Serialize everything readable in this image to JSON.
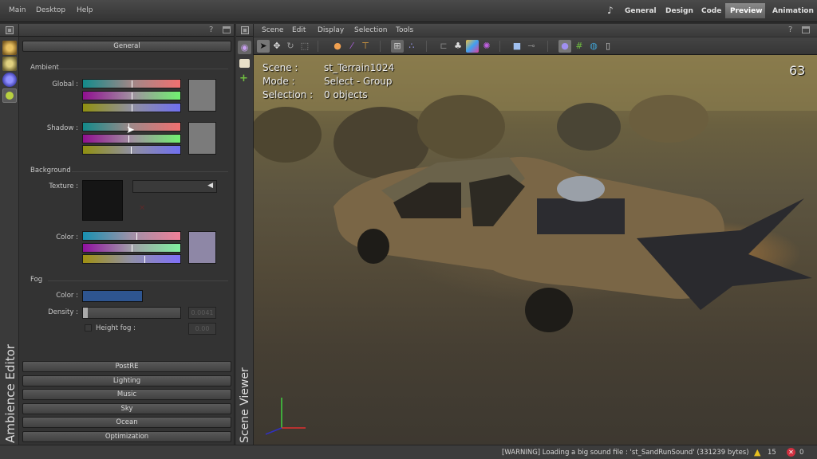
{
  "menubar": {
    "items": [
      "Main",
      "Desktop",
      "Help"
    ],
    "workspace_tabs": [
      "General",
      "Design",
      "Code",
      "Preview",
      "Animation"
    ],
    "active_workspace": "Preview",
    "music_icon": "music-note-icon"
  },
  "left_panel": {
    "title_vertical": "Ambience Editor",
    "help": "?",
    "general_button": "General",
    "ambient": {
      "label": "Ambient",
      "global_label": "Global :",
      "shadow_label": "Shadow :",
      "global_ticks": [
        0.5,
        0.5,
        0.5
      ],
      "shadow_ticks": [
        0.47,
        0.47,
        0.49
      ],
      "global_swatch": "#7b7b7b",
      "shadow_swatch": "#7b7b7b"
    },
    "background": {
      "label": "Background",
      "texture_label": "Texture :",
      "color_label": "Color :",
      "color_ticks": [
        0.55,
        0.5,
        0.63
      ],
      "color_swatch": "#8e87a6"
    },
    "fog": {
      "label": "Fog",
      "color_label": "Color :",
      "color_value": "#2e5590",
      "density_label": "Density :",
      "density_value": "0.0041",
      "density_fraction": 0.04,
      "height_fog_label": "Height fog :",
      "height_fog_value": "0.00",
      "height_fog_checked": false
    },
    "sections": [
      "PostRE",
      "Lighting",
      "Music",
      "Sky",
      "Ocean",
      "Optimization"
    ]
  },
  "scene_viewer": {
    "title_vertical": "Scene Viewer",
    "menu": [
      "Scene",
      "Edit",
      "Display",
      "Selection",
      "Tools"
    ],
    "help": "?",
    "overlay": {
      "scene_label": "Scene :",
      "scene_value": "st_Terrain1024",
      "mode_label": "Mode :",
      "mode_value": "Select - Group",
      "selection_label": "Selection :",
      "selection_value": "0 objects",
      "fps": "63"
    }
  },
  "statusbar": {
    "message": "[WARNING] Loading a big sound file : 'st_SandRunSound' (331239 bytes)",
    "warnings": "15",
    "errors": "0"
  }
}
